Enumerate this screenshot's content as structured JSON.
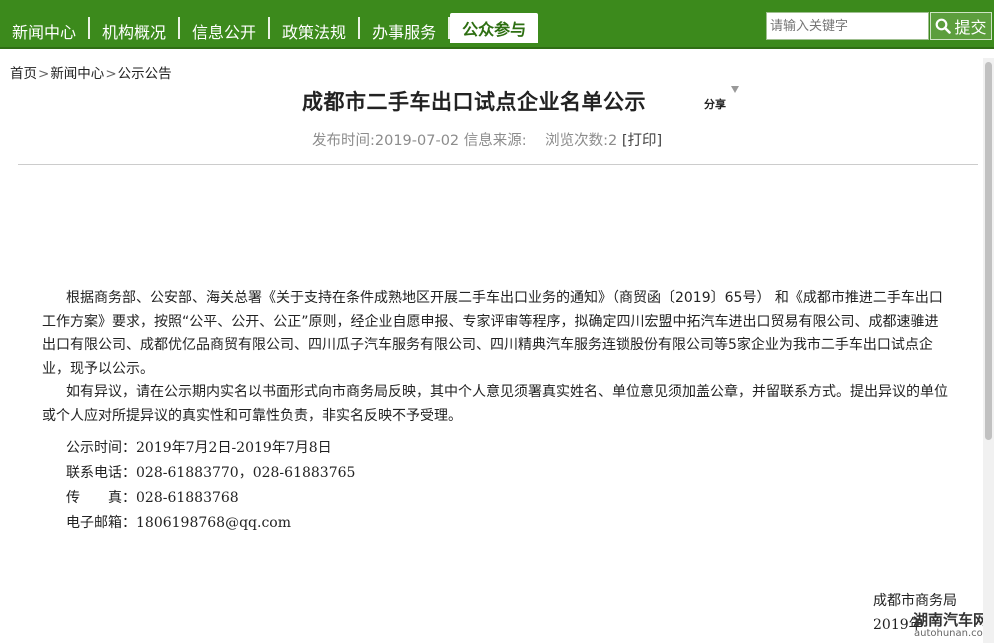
{
  "nav": {
    "items": [
      {
        "label": "新闻中心"
      },
      {
        "label": "机构概况"
      },
      {
        "label": "信息公开"
      },
      {
        "label": "政策法规"
      },
      {
        "label": "办事服务"
      },
      {
        "label": "公众参与"
      }
    ],
    "active_index": 5,
    "search": {
      "placeholder": "请输入关键字",
      "button_label": "提交",
      "icon": "search-icon"
    }
  },
  "colors": {
    "nav_bg": "#3c8a1c",
    "active_text": "#2e6f12",
    "meta_text": "#8c8c8c"
  },
  "breadcrumb": {
    "items": [
      "首页",
      "新闻中心",
      "公示公告"
    ],
    "separator": ">"
  },
  "article": {
    "title": "成都市二手车出口试点企业名单公示",
    "share_label": "分享",
    "meta": {
      "publish": "发布时间:2019-07-02",
      "source": "信息来源:",
      "views_label": "浏览次数:",
      "views": "2",
      "print": "[打印]"
    },
    "paragraphs": [
      "根据商务部、公安部、海关总署《关于支持在条件成熟地区开展二手车出口业务的通知》（商贸函〔2019〕65号） 和《成都市推进二手车出口工作方案》要求，按照“公平、公开、公正”原则，经企业自愿申报、专家评审等程序，拟确定四川宏盟中拓汽车进出口贸易有限公司、成都速骓进出口有限公司、成都优亿品商贸有限公司、四川瓜子汽车服务有限公司、四川精典汽车服务连锁股份有限公司等5家企业为我市二手车出口试点企业，现予以公示。",
      "如有异议，请在公示期内实名以书面形式向市商务局反映，其中个人意见须署真实姓名、单位意见须加盖公章，并留联系方式。提出异议的单位或个人应对所提异议的真实性和可靠性负责，非实名反映不予受理。"
    ],
    "info": {
      "period_label": "公示时间：",
      "period_value": "2019年7月2日-2019年7月8日",
      "phone_label": "联系电话：",
      "phone_value": "028-61883770，028-61883765",
      "fax_label": "传　　真：",
      "fax_value": "028-61883768",
      "email_label": "电子邮箱：",
      "email_value": "1806198768@qq.com"
    },
    "signature": {
      "org": "成都市商务局",
      "date": "2019年"
    }
  },
  "watermark": {
    "text": "湖南汽车网",
    "url": "autohunan.com"
  }
}
